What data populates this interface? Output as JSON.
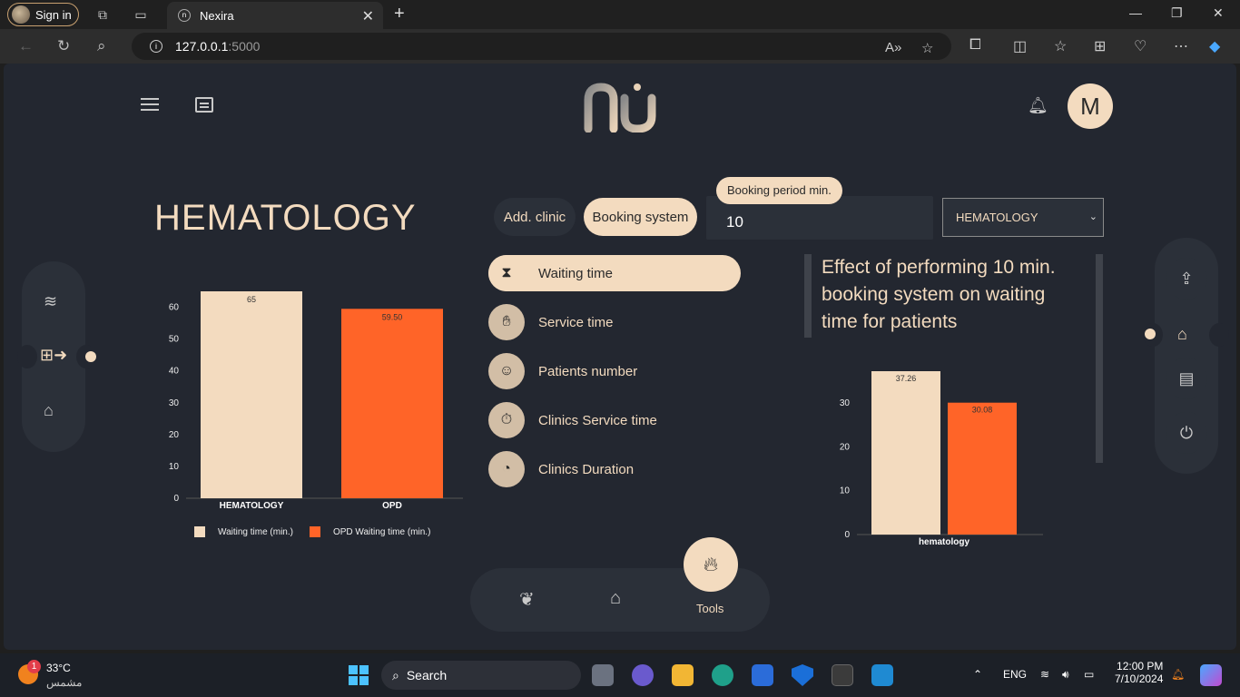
{
  "browser": {
    "signin_label": "Sign in",
    "tab_title": "Nexira",
    "url_host": "127.0.0.1",
    "url_port": ":5000"
  },
  "header": {
    "avatar_letter": "M"
  },
  "page": {
    "title": "HEMATOLOGY",
    "add_clinic_label": "Add. clinic",
    "booking_system_label": "Booking system",
    "booking_period_label": "Booking period min.",
    "booking_period_value": "10",
    "clinic_select_value": "HEMATOLOGY",
    "menu": [
      {
        "label": "Waiting time",
        "icon": "hourglass-icon"
      },
      {
        "label": "Service time",
        "icon": "service-hand-icon"
      },
      {
        "label": "Patients number",
        "icon": "patient-icon"
      },
      {
        "label": "Clinics Service time",
        "icon": "stopwatch-icon"
      },
      {
        "label": "Clinics Duration",
        "icon": "duration-icon"
      }
    ],
    "effect_text": "Effect of performing 10 min. booking system on waiting time for patients",
    "tools_label": "Tools"
  },
  "chart_data": [
    {
      "type": "bar",
      "categories": [
        "HEMATOLOGY",
        "OPD"
      ],
      "values": [
        65,
        59.5
      ],
      "value_labels": [
        "65",
        "59.50"
      ],
      "colors": [
        "#f3dbbf",
        "#ff6428"
      ],
      "legend": [
        "Waiting time (min.)",
        "OPD Waiting time (min.)"
      ],
      "ylim": [
        0,
        65
      ],
      "yticks": [
        0,
        10,
        20,
        30,
        40,
        50,
        60
      ]
    },
    {
      "type": "bar",
      "categories": [
        "hematology"
      ],
      "series": [
        {
          "values": [
            37.26
          ],
          "color": "#f3dbbf"
        },
        {
          "values": [
            30.08
          ],
          "color": "#ff6428"
        }
      ],
      "value_labels": [
        "37.26",
        "30.08"
      ],
      "ylim": [
        0,
        37.26
      ],
      "yticks": [
        0,
        10,
        20,
        30
      ]
    }
  ],
  "taskbar": {
    "temperature": "33°C",
    "weather_text": "مشمس",
    "weather_badge": "1",
    "search_label": "Search",
    "lang": "ENG",
    "time": "12:00 PM",
    "date": "7/10/2024"
  }
}
